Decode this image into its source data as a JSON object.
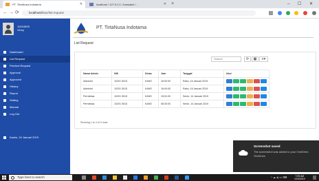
{
  "browser": {
    "tabs": [
      {
        "label": "PT. TirtaNusa Indotama",
        "active": true
      },
      {
        "label": "localhost / 127.0.0.1 / transaksi / ...",
        "active": false
      }
    ],
    "url_prefix": "localhost",
    "url_rest": "/blue/list-request",
    "new_tab": "+",
    "window": {
      "minimize": "–",
      "maximize": "☐",
      "close": "✕"
    },
    "nav": {
      "back": "←",
      "forward": "→",
      "reload": "⟳"
    }
  },
  "sidebar": {
    "user": {
      "line1": "10215909",
      "line2": "Vinny"
    },
    "items": [
      {
        "label": "Dashboard",
        "active": false
      },
      {
        "label": "List Request",
        "active": true
      },
      {
        "label": "Preview Request",
        "active": false
      },
      {
        "label": "Approval",
        "active": false
      },
      {
        "label": "Approved",
        "active": false
      },
      {
        "label": "History",
        "active": false
      },
      {
        "label": "Report",
        "active": false
      },
      {
        "label": "Setting",
        "active": false
      },
      {
        "label": "Manual",
        "active": false
      },
      {
        "label": "Log Out",
        "active": false
      }
    ],
    "date": "Kamis, 24 Januari 2019"
  },
  "main": {
    "brand": "PT. TirtaNusa Indotama",
    "page_title": "List Request",
    "search_placeholder": "Search",
    "toolbar": {
      "refresh": "⟳",
      "columns": "▦",
      "export": "≡▾"
    },
    "table": {
      "headers": [
        "Nama Admin",
        "NIK",
        "Dinas",
        "Jam",
        "Tanggal",
        "Aksi"
      ],
      "rows": [
        [
          "Administ",
          "10201 5015",
          "KANS",
          "16:00:00",
          "Rabu, 16 Januari 2019"
        ],
        [
          "Administ",
          "10201 5015",
          "KANS",
          "16:00:00",
          "Rabu, 16 Januari 2019"
        ],
        [
          "Permintaa",
          "10201 5015",
          "KANS",
          "15:51:00",
          "Senin, 14 Januari 2019"
        ],
        [
          "Permintaa",
          "10201 5015",
          "KANS",
          "08:30:00",
          "Senin, 14 Januari 2019"
        ]
      ]
    },
    "footer": "Showing 1 to 4 of 4 rows"
  },
  "toast": {
    "title": "Screenshot saved",
    "body": "The screenshot was added to your OneDrive.",
    "app": "OneDrive"
  },
  "taskbar": {
    "search_placeholder": "Type here to search",
    "time": "7:05 AM",
    "date": "1/24/2019"
  },
  "colors": {
    "sidebar": "#1f4ca7",
    "action_buttons": [
      "#2f7fd6",
      "#2eb872",
      "#2eb872",
      "#f0ad4e",
      "#d9534f",
      "#1e88e5"
    ]
  }
}
